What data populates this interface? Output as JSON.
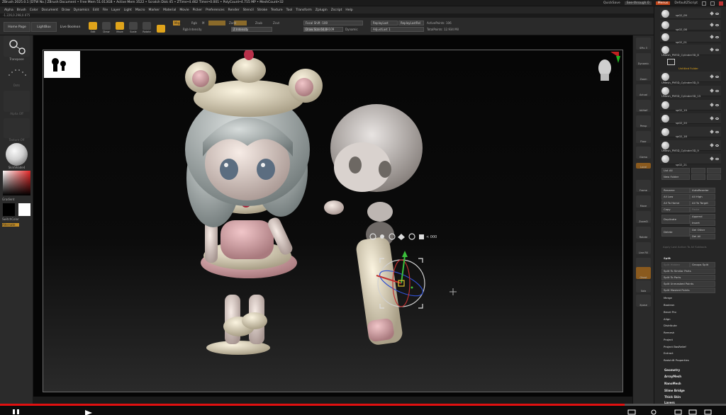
{
  "titlebar": {
    "text": "ZBrush 2025.0.1 [DTW No.]   ZBrush Document    • Free Mem 51.013GB • Active Mem 3522 • Scratch Disk 45 • ZTime•4.462 Timer•0.001 • PolyCount•4.715 MP • MeshCount•32",
    "quicksave": "QuickSave",
    "see_through": "See-through  0",
    "menus_btn": "Menus",
    "script": "DefaultZScript"
  },
  "menu": [
    "Alpha",
    "Brush",
    "Color",
    "Document",
    "Draw",
    "Dynamics",
    "Edit",
    "File",
    "Layer",
    "Light",
    "Macro",
    "Marker",
    "Material",
    "Movie",
    "Picker",
    "Preferences",
    "Render",
    "Stencil",
    "Stroke",
    "Texture",
    "Tool",
    "Transform",
    "Zplugin",
    "Zscript",
    "Help"
  ],
  "coords": "-1.226,0.298,0.075",
  "toolbar": {
    "home_page": "Home Page",
    "lightbox": "LightBox",
    "live_boolean": "Live Boolean",
    "edit": "Edit",
    "draw": "Draw",
    "move": "Move",
    "scale": "Scale",
    "rotate": "Rotate",
    "mrgb": "Mrgb",
    "rgb": "Rgb",
    "m": "M",
    "zadd": "Zadd",
    "zsub": "Zsub",
    "zcut": "Zcut",
    "rgb_intensity": "Rgb Intensity",
    "z_intensity": "Z Intensity",
    "focal_shift": "Focal Shift -100",
    "draw_size": "Draw Size 64.88109",
    "dynamic": "Dynamic",
    "replay_last": "ReplayLast",
    "replay_last_rel": "ReplayLastRel",
    "adjust_last": "AdjustLast 1",
    "active_points": "ActivePoints: 106",
    "total_points": "TotalPoints: 12.934 Mil"
  },
  "leftshelf": {
    "transpose": "Transpose",
    "dots": "Dots",
    "alpha_off": "Alpha Off",
    "texture_off": "Texture Off",
    "matcap": "SkinShade4",
    "gradient": "Gradient",
    "switch_color": "SwitchColor",
    "alternate": "Alternate"
  },
  "rightstrip": [
    "SPix 3",
    "Dynamic",
    "Zoom",
    "Actual",
    "AAHalf",
    "Persp",
    "Floor",
    "Gizmo",
    "",
    "Local",
    "Frame",
    "Move",
    "ZoomD",
    "Rotate",
    "Line Fill",
    "Transp",
    "Ghost",
    "Solo",
    "Xpose"
  ],
  "subtools": {
    "folder": "Untitled Folder",
    "items": [
      {
        "name": "sp02_09"
      },
      {
        "name": "sp02_08"
      },
      {
        "name": "sp02_01"
      },
      {
        "name": "UMesh_PM3D_Cylinder3D_8"
      },
      {
        "name": "UMesh_PM3D_Cylinder3D_5"
      },
      {
        "name": "UMesh_PM3D_Cylinder3D_15"
      },
      {
        "name": "sp02_19"
      },
      {
        "name": "sp02_20"
      },
      {
        "name": "sp02_18"
      },
      {
        "name": "UMesh_PM3D_Cylinder3D_9"
      },
      {
        "name": "sp02_21"
      }
    ]
  },
  "panel": {
    "list_all": "List All",
    "new_folder": "New Folder",
    "rename": "Rename",
    "auto_reorder": "AutoReorder",
    "all_low": "All Low",
    "all_high": "All High",
    "all_to_home": "All To Home",
    "all_to_target": "All To Target",
    "copy": "Copy",
    "paste": "Paste",
    "duplicate": "Duplicate",
    "append": "Append",
    "insert": "Insert",
    "delete": "Delete",
    "del_other": "Del Other",
    "del_all": "Del All",
    "apply_last": "Apply Last Action To All Subtools",
    "split": "Split",
    "split_hidden": "Split Hidden",
    "groups_split": "Groups Split",
    "split_similar": "Split To Similar Parts",
    "split_parts": "Split To Parts",
    "split_unmasked": "Split Unmasked Points",
    "split_masked": "Split Masked Points",
    "merge": "Merge",
    "boolean": "Boolean",
    "bevel_pro": "Bevel Pro",
    "align": "Align",
    "distribute": "Distribute",
    "remesh": "Remesh",
    "project": "Project",
    "project_bas": "Project BasRelief",
    "extract": "Extract",
    "redshift": "Redshift Properties",
    "geometry": "Geometry",
    "arraymesh": "ArrayMesh",
    "nanomesh": "NanoMesh",
    "slime_bridge": "Slime Bridge",
    "thick_skin": "Thick Skin",
    "layers": "Layers"
  },
  "viewport": {
    "gizmo_label": "< 000",
    "video_progress": 0.86
  },
  "colors": {
    "accent": "#e0a41b",
    "selected_menu": "#c0461b",
    "progress": "#e01010"
  }
}
